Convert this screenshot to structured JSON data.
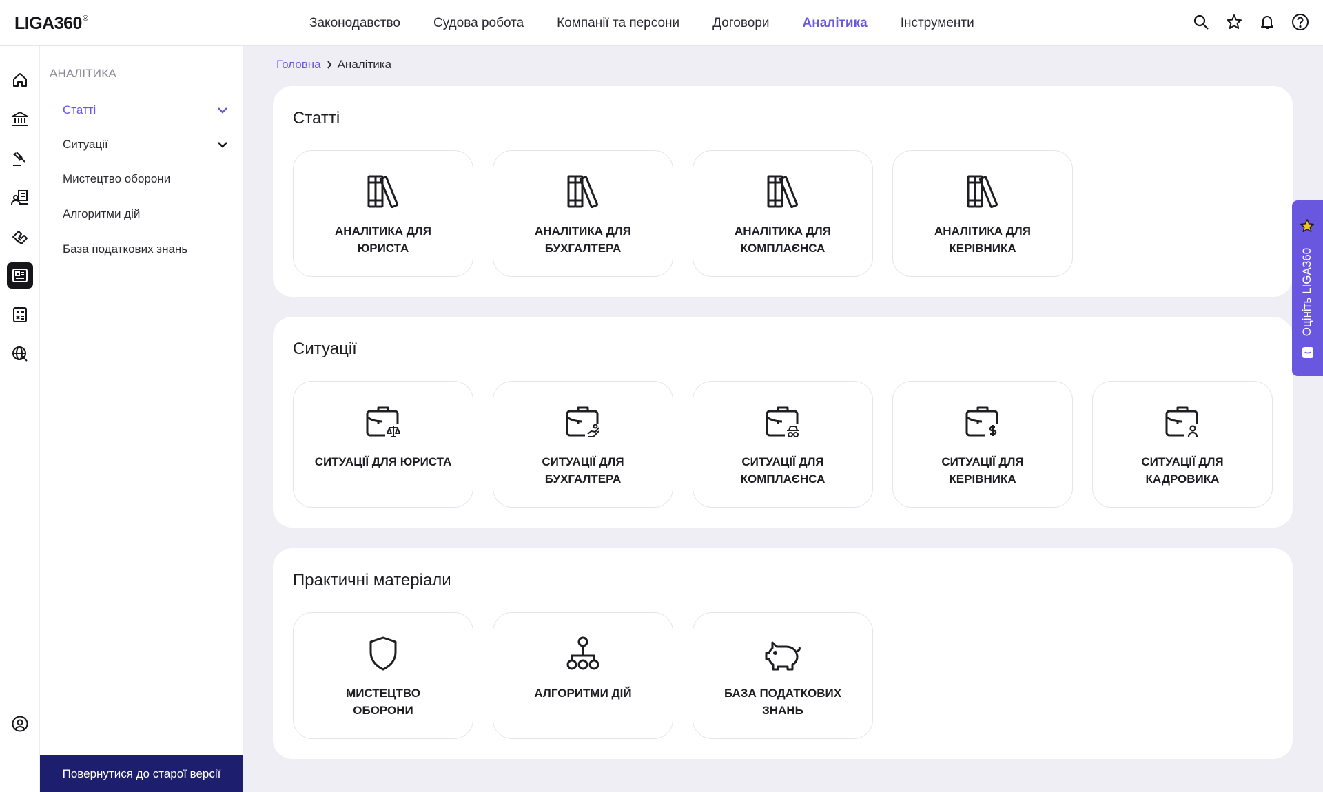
{
  "logo": {
    "text": "LIGA360",
    "mark": "®"
  },
  "nav": {
    "items": [
      {
        "label": "Законодавство"
      },
      {
        "label": "Судова робота"
      },
      {
        "label": "Компанії та персони"
      },
      {
        "label": "Договори"
      },
      {
        "label": "Аналітика"
      },
      {
        "label": "Інструменти"
      }
    ],
    "active": "Аналітика"
  },
  "top_icons": [
    "search-icon",
    "star-icon",
    "bell-icon",
    "help-icon"
  ],
  "rail_icons": [
    "home-icon",
    "bank-icon",
    "gavel-icon",
    "companies-icon",
    "handshake-icon",
    "newspaper-icon",
    "calculator-icon",
    "globe-icon",
    "user-circle-icon"
  ],
  "sidebar": {
    "title": "АНАЛІТИКА",
    "items": [
      {
        "label": "Статті",
        "expandable": true,
        "active": true
      },
      {
        "label": "Ситуації",
        "expandable": true
      },
      {
        "label": "Мистецтво оборони"
      },
      {
        "label": "Алгоритми дій"
      },
      {
        "label": "База податкових знань"
      }
    ],
    "old_version": "Повернутися до старої версії"
  },
  "breadcrumb": {
    "home": "Головна",
    "current": "Аналітика"
  },
  "sections": [
    {
      "title": "Статті",
      "cards": [
        {
          "label": "АНАЛІТИКА ДЛЯ ЮРИСТА",
          "icon": "books-icon"
        },
        {
          "label": "АНАЛІТИКА ДЛЯ БУХГАЛТЕРА",
          "icon": "books-icon"
        },
        {
          "label": "АНАЛІТИКА ДЛЯ КОМПЛАЄНСА",
          "icon": "books-icon"
        },
        {
          "label": "АНАЛІТИКА ДЛЯ КЕРІВНИКА",
          "icon": "books-icon"
        }
      ]
    },
    {
      "title": "Ситуації",
      "cards": [
        {
          "label": "СИТУАЦІЇ ДЛЯ ЮРИСТА",
          "icon": "briefcase-scales-icon"
        },
        {
          "label": "СИТУАЦІЇ ДЛЯ БУХГАЛТЕРА",
          "icon": "briefcase-coins-icon"
        },
        {
          "label": "СИТУАЦІЇ ДЛЯ КОМПЛАЄНСА",
          "icon": "briefcase-spy-icon"
        },
        {
          "label": "СИТУАЦІЇ ДЛЯ КЕРІВНИКА",
          "icon": "briefcase-dollar-icon"
        },
        {
          "label": "СИТУАЦІЇ ДЛЯ КАДРОВИКА",
          "icon": "briefcase-person-icon"
        }
      ]
    },
    {
      "title": "Практичні матеріали",
      "cards": [
        {
          "label": "МИСТЕЦТВО ОБОРОНИ",
          "icon": "shield-icon"
        },
        {
          "label": "АЛГОРИТМИ ДІЙ",
          "icon": "hierarchy-icon"
        },
        {
          "label": "БАЗА ПОДАТКОВИХ ЗНАНЬ",
          "icon": "piggy-bank-icon"
        }
      ]
    }
  ],
  "rate_tab": {
    "label": "Оцініть LIGA360"
  },
  "colors": {
    "accent": "#6a57e0",
    "old_version_bg": "#1d1e6e",
    "page_bg": "#eeeef4"
  }
}
